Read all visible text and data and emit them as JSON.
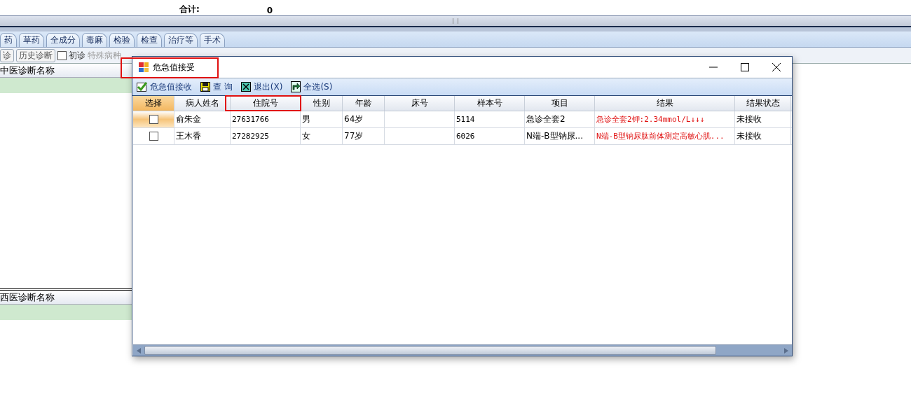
{
  "totals": {
    "label": "合计:",
    "value": "0"
  },
  "tabs": [
    {
      "label": "药",
      "selected": false
    },
    {
      "label": "草药",
      "selected": false
    },
    {
      "label": "全成分",
      "selected": false
    },
    {
      "label": "毒麻",
      "selected": false
    },
    {
      "label": "检验",
      "selected": false
    },
    {
      "label": "检查",
      "selected": false
    },
    {
      "label": "治疗等",
      "selected": false
    },
    {
      "label": "手术",
      "selected": false
    }
  ],
  "diagnosis_bar": {
    "buttons": [
      "诊",
      "历史诊断"
    ],
    "first_visit": {
      "label": "初诊",
      "checked": false
    },
    "special_disease": {
      "label": "特殊病种",
      "disabled": true
    }
  },
  "tcm_diagnosis": {
    "header": "中医诊断名称"
  },
  "western_diagnosis": {
    "header": "西医诊断名称"
  },
  "dialog": {
    "title": "危急值接受",
    "title_highlighted": true,
    "toolbar": [
      {
        "label": "危急值接收",
        "kind": "accept"
      },
      {
        "label": "查 询",
        "kind": "save"
      },
      {
        "label": "退出(X)",
        "kind": "exit"
      },
      {
        "label": "全选(S)",
        "kind": "selectall"
      }
    ],
    "columns": [
      {
        "label": "选择",
        "highlighted": false
      },
      {
        "label": "病人姓名",
        "highlighted": false
      },
      {
        "label": "住院号",
        "highlighted": true
      },
      {
        "label": "性别",
        "highlighted": false
      },
      {
        "label": "年龄",
        "highlighted": false
      },
      {
        "label": "床号",
        "highlighted": false
      },
      {
        "label": "样本号",
        "highlighted": false
      },
      {
        "label": "项目",
        "highlighted": false
      },
      {
        "label": "结果",
        "highlighted": false
      },
      {
        "label": "结果状态",
        "highlighted": false
      }
    ],
    "rows": [
      {
        "current": true,
        "checked": false,
        "name": "俞朱金",
        "admission_no": "27631766",
        "sex": "男",
        "age": "64岁",
        "bed": "",
        "sample_no": "5114",
        "item": "急诊全套2",
        "result": "急诊全套2钾:2.34mmol/L↓↓↓",
        "abnormal": true,
        "status": "未接收"
      },
      {
        "current": false,
        "checked": false,
        "name": "王木香",
        "admission_no": "27282925",
        "sex": "女",
        "age": "77岁",
        "bed": "",
        "sample_no": "6026",
        "item": "N端-B型钠尿...",
        "result": "N端-B型钠尿肽前体测定高敏心肌...",
        "abnormal": true,
        "status": "未接收"
      }
    ]
  }
}
